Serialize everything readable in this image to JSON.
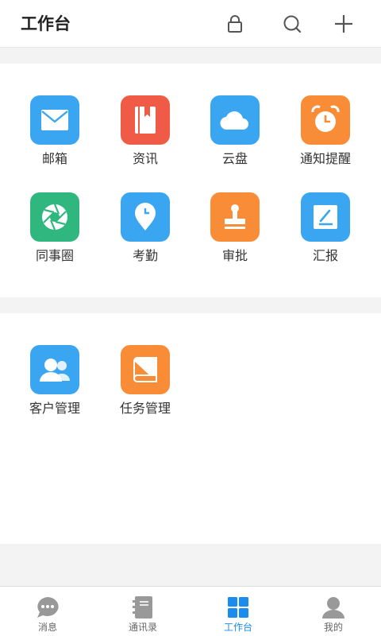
{
  "header": {
    "title": "工作台",
    "icons": [
      "lock-icon",
      "search-icon",
      "plus-icon"
    ]
  },
  "sections": [
    {
      "apps": [
        {
          "label": "邮箱",
          "icon": "mail-icon",
          "color": "#3aa6f2"
        },
        {
          "label": "资讯",
          "icon": "notebook-icon",
          "color": "#ef5b46"
        },
        {
          "label": "云盘",
          "icon": "cloud-icon",
          "color": "#3aa6f2"
        },
        {
          "label": "通知提醒",
          "icon": "alarm-clock-icon",
          "color": "#f98c36"
        },
        {
          "label": "同事圈",
          "icon": "aperture-icon",
          "color": "#2fb77f"
        },
        {
          "label": "考勤",
          "icon": "location-clock-icon",
          "color": "#3aa6f2"
        },
        {
          "label": "审批",
          "icon": "stamp-icon",
          "color": "#f98c36"
        },
        {
          "label": "汇报",
          "icon": "edit-icon",
          "color": "#3aa6f2"
        }
      ]
    },
    {
      "apps": [
        {
          "label": "客户管理",
          "icon": "contacts-icon",
          "color": "#3aa6f2"
        },
        {
          "label": "任务管理",
          "icon": "book-icon",
          "color": "#f98c36"
        }
      ]
    }
  ],
  "tabbar": {
    "tabs": [
      {
        "label": "消息",
        "icon": "chat-bubble-icon",
        "active": false
      },
      {
        "label": "通讯录",
        "icon": "address-book-icon",
        "active": false
      },
      {
        "label": "工作台",
        "icon": "grid-icon",
        "active": true
      },
      {
        "label": "我的",
        "icon": "user-icon",
        "active": false
      }
    ],
    "active_color": "#1a8cf0",
    "inactive_color": "#999999"
  }
}
